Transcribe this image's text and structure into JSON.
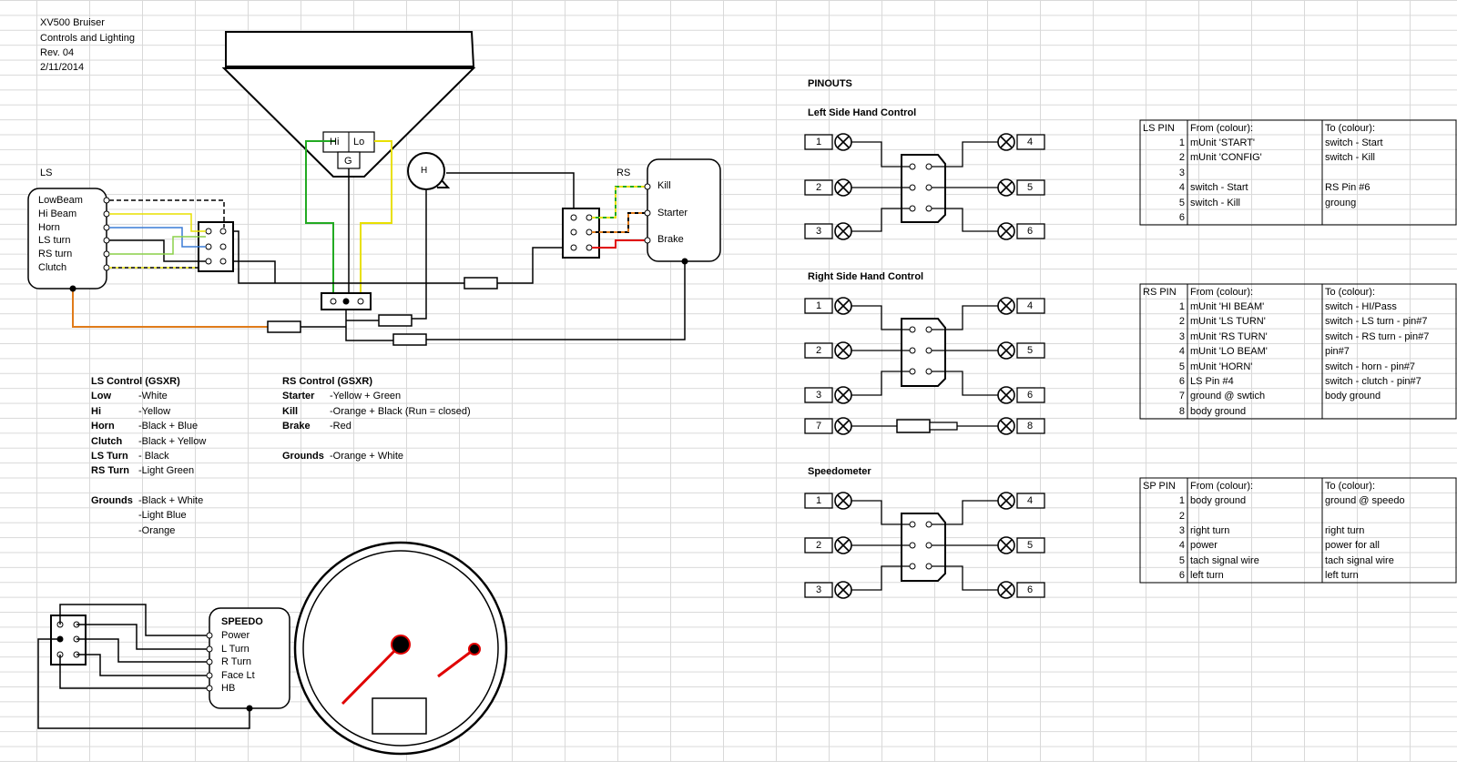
{
  "header": {
    "title": "XV500 Bruiser",
    "subtitle": "Controls and Lighting",
    "rev": "Rev. 04",
    "date": "2/11/2014"
  },
  "headlight": {
    "hi": "Hi",
    "lo": "Lo",
    "g": "G"
  },
  "horn": {
    "label": "H"
  },
  "ls_switch": {
    "label": "LS",
    "items": [
      "LowBeam",
      "Hi Beam",
      "Horn",
      "LS turn",
      "RS turn",
      "Clutch"
    ]
  },
  "rs_switch": {
    "label": "RS",
    "items": [
      "Kill",
      "Starter",
      "Brake"
    ]
  },
  "ls_control": {
    "title": "LS Control (GSXR)",
    "rows": [
      {
        "k": "Low",
        "v": "-White"
      },
      {
        "k": "Hi",
        "v": "-Yellow"
      },
      {
        "k": "Horn",
        "v": "-Black + Blue"
      },
      {
        "k": "Clutch",
        "v": "-Black + Yellow"
      },
      {
        "k": "LS Turn",
        "v": "- Black"
      },
      {
        "k": "RS Turn",
        "v": "-Light Green"
      }
    ],
    "grounds_label": "Grounds",
    "grounds": [
      "-Black + White",
      "-Light Blue",
      "-Orange"
    ]
  },
  "rs_control": {
    "title": "RS Control (GSXR)",
    "rows": [
      {
        "k": "Starter",
        "v": "-Yellow + Green"
      },
      {
        "k": "Kill",
        "v": "-Orange + Black (Run = closed)"
      },
      {
        "k": "Brake",
        "v": "-Red"
      }
    ],
    "grounds_label": "Grounds",
    "grounds": "-Orange + White"
  },
  "speedo": {
    "title": "SPEEDO",
    "items": [
      "Power",
      "L Turn",
      "R Turn",
      "Face Lt",
      "HB"
    ]
  },
  "pinouts": {
    "title": "PINOUTS",
    "left_title": "Left Side Hand Control",
    "right_title": "Right Side Hand Control",
    "speedo_title": "Speedometer",
    "pins_left": [
      "1",
      "2",
      "3"
    ],
    "pins_right": [
      "4",
      "5",
      "6"
    ],
    "pins_extra": [
      "7",
      "8"
    ]
  },
  "tables": {
    "ls": {
      "h": [
        "LS PIN",
        "From (colour):",
        "To (colour):"
      ],
      "rows": [
        [
          "1",
          "mUnit 'START'",
          "switch - Start"
        ],
        [
          "2",
          "mUnit 'CONFIG'",
          "switch - Kill"
        ],
        [
          "3",
          "",
          ""
        ],
        [
          "4",
          "switch - Start",
          "RS Pin #6"
        ],
        [
          "5",
          "switch - Kill",
          "groung"
        ],
        [
          "6",
          "",
          ""
        ]
      ]
    },
    "rs": {
      "h": [
        "RS PIN",
        "From (colour):",
        "To (colour):"
      ],
      "rows": [
        [
          "1",
          "mUnit 'HI BEAM'",
          "switch - HI/Pass"
        ],
        [
          "2",
          "mUnit 'LS TURN'",
          "switch - LS turn - pin#7"
        ],
        [
          "3",
          "mUnit 'RS TURN'",
          "switch - RS turn - pin#7"
        ],
        [
          "4",
          "mUnit 'LO BEAM'",
          "pin#7"
        ],
        [
          "5",
          "mUnit 'HORN'",
          "switch - horn - pin#7"
        ],
        [
          "6",
          "LS Pin #4",
          "switch - clutch - pin#7"
        ],
        [
          "7",
          "ground @ swtich",
          "body ground"
        ],
        [
          "8",
          "body ground",
          ""
        ]
      ]
    },
    "sp": {
      "h": [
        "SP PIN",
        "From (colour):",
        "To (colour):"
      ],
      "rows": [
        [
          "1",
          "body ground",
          "ground @ speedo"
        ],
        [
          "2",
          "",
          ""
        ],
        [
          "3",
          "right turn",
          "right turn"
        ],
        [
          "4",
          "power",
          "power for all"
        ],
        [
          "5",
          "tach signal wire",
          "tach signal wire"
        ],
        [
          "6",
          "left turn",
          "left turn"
        ]
      ]
    }
  },
  "colors": {
    "line": "#000000",
    "green": "#22aa22",
    "yellow": "#e8e000",
    "blue": "#3a7bd5",
    "lightgreen": "#8bd14a",
    "orange": "#e07b1a",
    "red": "#e00000"
  }
}
